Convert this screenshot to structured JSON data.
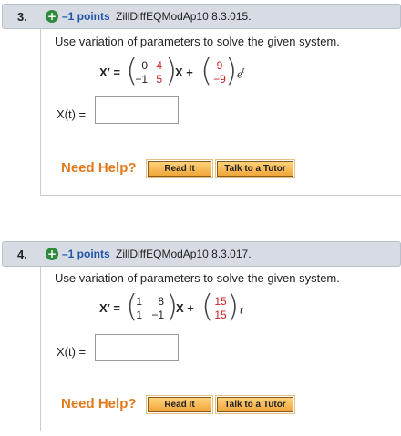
{
  "questions": [
    {
      "number": "3.",
      "plus": "+",
      "points": "–1 points",
      "code": "ZillDiffEQModAp10 8.3.015.",
      "prompt": "Use variation of parameters to solve the given system.",
      "x_prime": "X′ =",
      "A": [
        [
          "0",
          "4"
        ],
        [
          "−1",
          "5"
        ]
      ],
      "x_label": "X +",
      "f": [
        "9",
        "−9"
      ],
      "forcing": "e",
      "forcing_sup": "t",
      "answer_label": "X(t) =",
      "answer_value": "",
      "need_help": "Need Help?",
      "read_it": "Read It",
      "talk_tutor": "Talk to a Tutor"
    },
    {
      "number": "4.",
      "plus": "+",
      "points": "–1 points",
      "code": "ZillDiffEQModAp10 8.3.017.",
      "prompt": "Use variation of parameters to solve the given system.",
      "x_prime": "X′ =",
      "A": [
        [
          "1",
          "8"
        ],
        [
          "1",
          "−1"
        ]
      ],
      "x_label": "X +",
      "f": [
        "15",
        "15"
      ],
      "forcing": "t",
      "forcing_sup": "",
      "answer_label": "X(t) =",
      "answer_value": "",
      "need_help": "Need Help?",
      "read_it": "Read It",
      "talk_tutor": "Talk to a Tutor"
    }
  ],
  "colors": {
    "header_bg": "#d6dbe4",
    "points": "#2255aa",
    "need_help": "#e07a1c",
    "red_vector": "#cc2222"
  }
}
